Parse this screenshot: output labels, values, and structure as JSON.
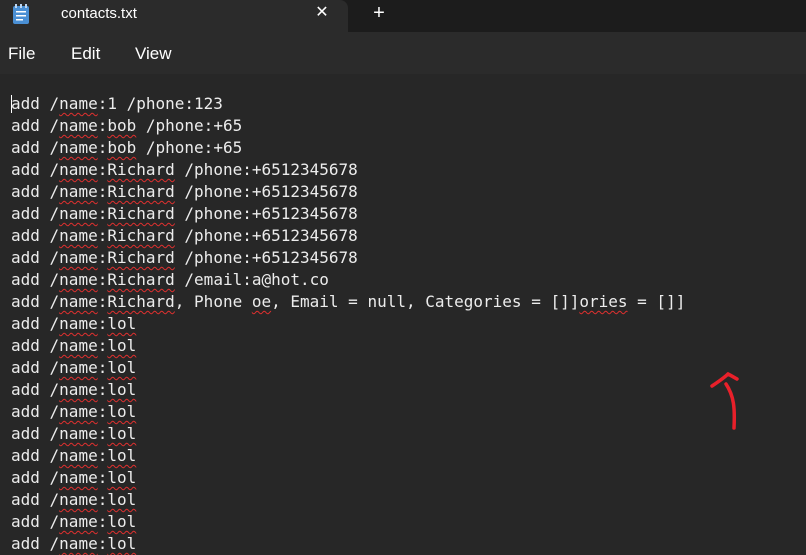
{
  "tab": {
    "title": "contacts.txt",
    "close_glyph": "✕",
    "new_tab_glyph": "+"
  },
  "icons": {
    "file": "notepad-file-icon",
    "close": "close-icon",
    "add": "plus-icon",
    "annotation": "red-arrow-annotation"
  },
  "menu": {
    "file": "File",
    "edit": "Edit",
    "view": "View"
  },
  "colors": {
    "titlebar": "#1c1c1c",
    "tab": "#2b2b2b",
    "editor_bg": "#272727",
    "text": "#ececec",
    "squiggle": "#e0302f",
    "annotation": "#e8202a",
    "icon_blue": "#4a8fd4"
  },
  "lines": [
    {
      "add": "add ",
      "slash": "/",
      "nm": "name",
      "rest": ":1 /phone:123"
    },
    {
      "add": "add ",
      "slash": "/",
      "nm": "name",
      "rest": ":",
      "w": "bob",
      "tail": " /phone:+65"
    },
    {
      "add": "add ",
      "slash": "/",
      "nm": "name",
      "rest": ":",
      "w": "bob",
      "tail": " /phone:+65"
    },
    {
      "add": "add ",
      "slash": "/",
      "nm": "name",
      "rest": ":",
      "w": "Richard",
      "tail": " /phone:+6512345678"
    },
    {
      "add": "add ",
      "slash": "/",
      "nm": "name",
      "rest": ":",
      "w": "Richard",
      "tail": " /phone:+6512345678"
    },
    {
      "add": "add ",
      "slash": "/",
      "nm": "name",
      "rest": ":",
      "w": "Richard",
      "tail": " /phone:+6512345678"
    },
    {
      "add": "add ",
      "slash": "/",
      "nm": "name",
      "rest": ":",
      "w": "Richard",
      "tail": " /phone:+6512345678"
    },
    {
      "add": "add ",
      "slash": "/",
      "nm": "name",
      "rest": ":",
      "w": "Richard",
      "tail": " /phone:+6512345678"
    },
    {
      "add": "add ",
      "slash": "/",
      "nm": "name",
      "rest": ":",
      "w": "Richard",
      "tail": " /email:a@hot.co"
    },
    {
      "add": "add ",
      "slash": "/",
      "nm": "name",
      "rest": ":",
      "w": "Richard",
      "tail": ", Phone ",
      "w2": "oe",
      "tail2": ", Email = null, Categories = []]",
      "w3": "ories",
      "tail3": " = []]"
    },
    {
      "add": "add ",
      "slash": "/",
      "nm": "name",
      "rest": ":",
      "w": "lol"
    },
    {
      "add": "add ",
      "slash": "/",
      "nm": "name",
      "rest": ":",
      "w": "lol"
    },
    {
      "add": "add ",
      "slash": "/",
      "nm": "name",
      "rest": ":",
      "w": "lol"
    },
    {
      "add": "add ",
      "slash": "/",
      "nm": "name",
      "rest": ":",
      "w": "lol"
    },
    {
      "add": "add ",
      "slash": "/",
      "nm": "name",
      "rest": ":",
      "w": "lol"
    },
    {
      "add": "add ",
      "slash": "/",
      "nm": "name",
      "rest": ":",
      "w": "lol"
    },
    {
      "add": "add ",
      "slash": "/",
      "nm": "name",
      "rest": ":",
      "w": "lol"
    },
    {
      "add": "add ",
      "slash": "/",
      "nm": "name",
      "rest": ":",
      "w": "lol"
    },
    {
      "add": "add ",
      "slash": "/",
      "nm": "name",
      "rest": ":",
      "w": "lol"
    },
    {
      "add": "add ",
      "slash": "/",
      "nm": "name",
      "rest": ":",
      "w": "lol"
    },
    {
      "add": "add ",
      "slash": "/",
      "nm": "name",
      "rest": ":",
      "w": "lol"
    }
  ]
}
